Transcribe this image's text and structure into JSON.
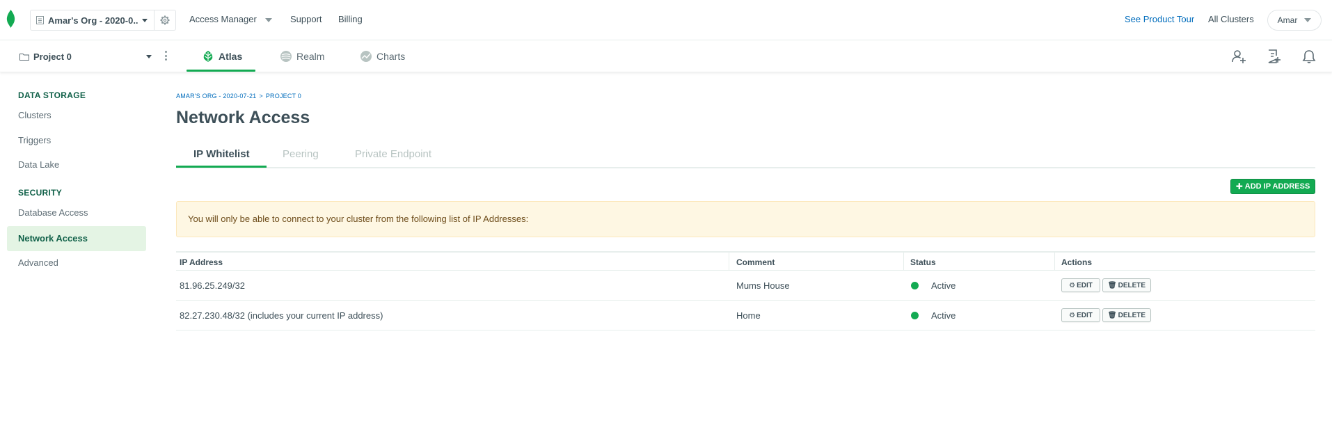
{
  "topbar": {
    "org_name": "Amar's Org - 2020-0...",
    "nav": {
      "access_manager": "Access Manager",
      "support": "Support",
      "billing": "Billing"
    },
    "product_tour": "See Product Tour",
    "all_clusters": "All Clusters",
    "user": "Amar"
  },
  "projectbar": {
    "project_name": "Project 0",
    "tabs": {
      "atlas": "Atlas",
      "realm": "Realm",
      "charts": "Charts"
    }
  },
  "sidebar": {
    "data_storage_heading": "DATA STORAGE",
    "security_heading": "SECURITY",
    "items": {
      "clusters": "Clusters",
      "triggers": "Triggers",
      "data_lake": "Data Lake",
      "database_access": "Database Access",
      "network_access": "Network Access",
      "advanced": "Advanced"
    }
  },
  "main": {
    "breadcrumb": {
      "org": "AMAR'S ORG - 2020-07-21",
      "separator": ">",
      "project": "PROJECT 0"
    },
    "title": "Network Access",
    "tabs": {
      "ip_whitelist": "IP Whitelist",
      "peering": "Peering",
      "private_endpoint": "Private Endpoint"
    },
    "add_button": "ADD IP ADDRESS",
    "notice": "You will only be able to connect to your cluster from the following list of IP Addresses:",
    "table": {
      "headers": {
        "ip": "IP Address",
        "comment": "Comment",
        "status": "Status",
        "actions": "Actions"
      },
      "rows": [
        {
          "ip": "81.96.25.249/32",
          "comment": "Mums House",
          "status": "Active",
          "edit": "EDIT",
          "delete": "DELETE"
        },
        {
          "ip": "82.27.230.48/32  (includes your current IP address)",
          "comment": "Home",
          "status": "Active",
          "edit": "EDIT",
          "delete": "DELETE"
        }
      ]
    }
  },
  "colors": {
    "brand_green": "#13aa52",
    "link_blue": "#006cbc",
    "notice_bg": "#fef7e3",
    "active_side_bg": "#e4f4e4"
  }
}
